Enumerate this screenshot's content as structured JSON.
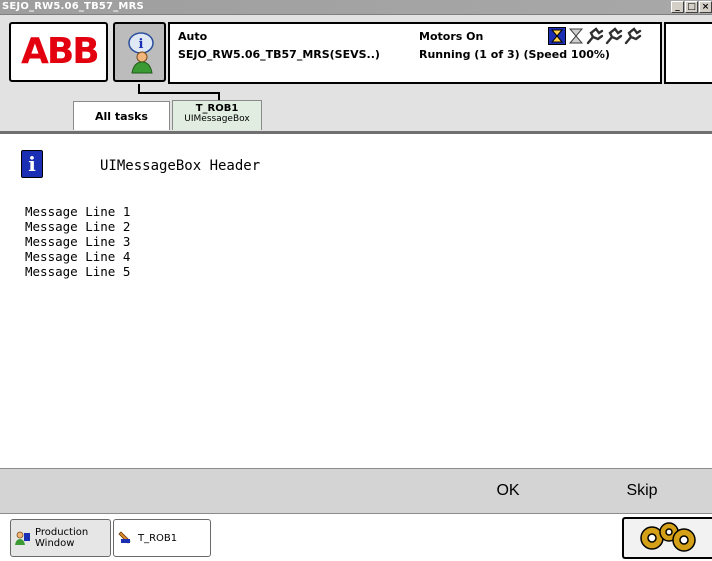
{
  "window": {
    "title": "SEJO_RW5.06_TB57_MRS",
    "minimize_glyph": "_",
    "maximize_glyph": "□",
    "close_glyph": "×"
  },
  "header": {
    "logo_text": "ABB",
    "mode": "Auto",
    "system_name": "SEJO_RW5.06_TB57_MRS(SEVS..)",
    "motors_state": "Motors On",
    "run_state": "Running (1 of 3) (Speed 100%)",
    "status_icons": [
      "hourglass-icon",
      "hourglass-icon",
      "mechanical-unit-icon",
      "mechanical-unit-icon",
      "mechanical-unit-icon"
    ]
  },
  "tabs": {
    "all_tasks": "All tasks",
    "active_task": "T_ROB1",
    "active_subtitle": "UIMessageBox"
  },
  "message": {
    "icon": "info-icon",
    "header": "UIMessageBox Header",
    "lines": [
      "Message Line 1",
      "Message Line 2",
      "Message Line 3",
      "Message Line 4",
      "Message Line 5"
    ]
  },
  "buttons": {
    "ok": "OK",
    "skip": "Skip"
  },
  "taskbar": {
    "production_window_line1": "Production",
    "production_window_line2": "Window",
    "t_rob1": "T_ROB1",
    "quickset_icon": "gears-icon"
  },
  "colors": {
    "abb_red": "#e3000f",
    "info_blue": "#1b2fb5",
    "active_tab_bg": "#e0ede0"
  }
}
